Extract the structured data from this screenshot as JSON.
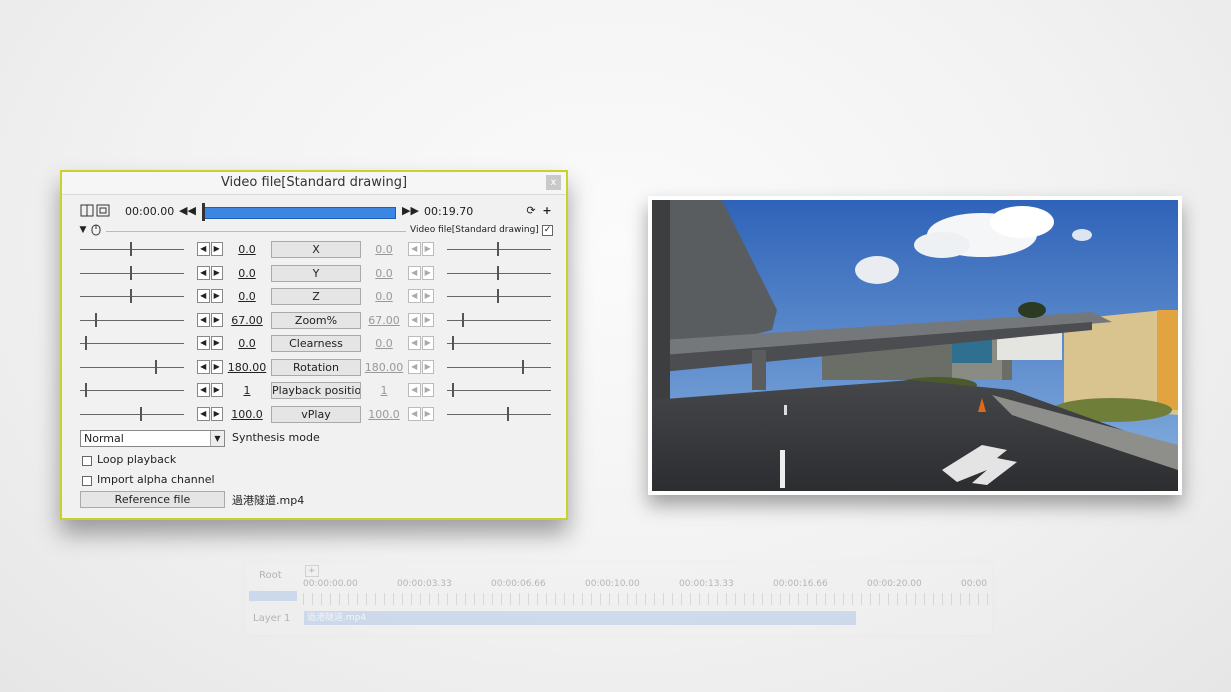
{
  "panel": {
    "title": "Video file[Standard drawing]",
    "close_label": "x",
    "time_start": "00:00.00",
    "time_end": "00:19.70",
    "playback_progress": 0.0,
    "object_label": "Video file[Standard drawing]",
    "object_checked": true,
    "params": [
      {
        "name": "X",
        "left": "0.0",
        "right": "0.0",
        "left_slider": 0.5,
        "right_slider": 0.5
      },
      {
        "name": "Y",
        "left": "0.0",
        "right": "0.0",
        "left_slider": 0.5,
        "right_slider": 0.5
      },
      {
        "name": "Z",
        "left": "0.0",
        "right": "0.0",
        "left_slider": 0.5,
        "right_slider": 0.5
      },
      {
        "name": "Zoom%",
        "left": "67.00",
        "right": "67.00",
        "left_slider": 0.15,
        "right_slider": 0.15
      },
      {
        "name": "Clearness",
        "left": "0.0",
        "right": "0.0",
        "left_slider": 0.05,
        "right_slider": 0.05
      },
      {
        "name": "Rotation",
        "left": "180.00",
        "right": "180.00",
        "left_slider": 0.75,
        "right_slider": 0.75
      },
      {
        "name": "Playback position",
        "left": "1",
        "right": "1",
        "left_slider": 0.05,
        "right_slider": 0.05
      },
      {
        "name": "vPlay",
        "left": "100.0",
        "right": "100.0",
        "left_slider": 0.6,
        "right_slider": 0.6
      }
    ],
    "synthesis_mode_value": "Normal",
    "synthesis_mode_label": "Synthesis mode",
    "loop_playback_label": "Loop playback",
    "import_alpha_label": "Import alpha channel",
    "reference_file_label": "Reference file",
    "file_name": "過港隧道.mp4"
  },
  "timeline": {
    "root_label": "Root",
    "layer_label": "Layer 1",
    "ticks": [
      "00:00:00.00",
      "00:00:03.33",
      "00:00:06.66",
      "00:00:10.00",
      "00:00:13.33",
      "00:00:16.66",
      "00:00:20.00",
      "00:00"
    ],
    "clip_label": "過港隧道.mp4"
  },
  "icons": {
    "rewind": "double-left-arrow",
    "forward": "double-right-arrow"
  },
  "colors": {
    "panel_border": "#c8d22a",
    "timeline_fill": "#3b86e3"
  }
}
